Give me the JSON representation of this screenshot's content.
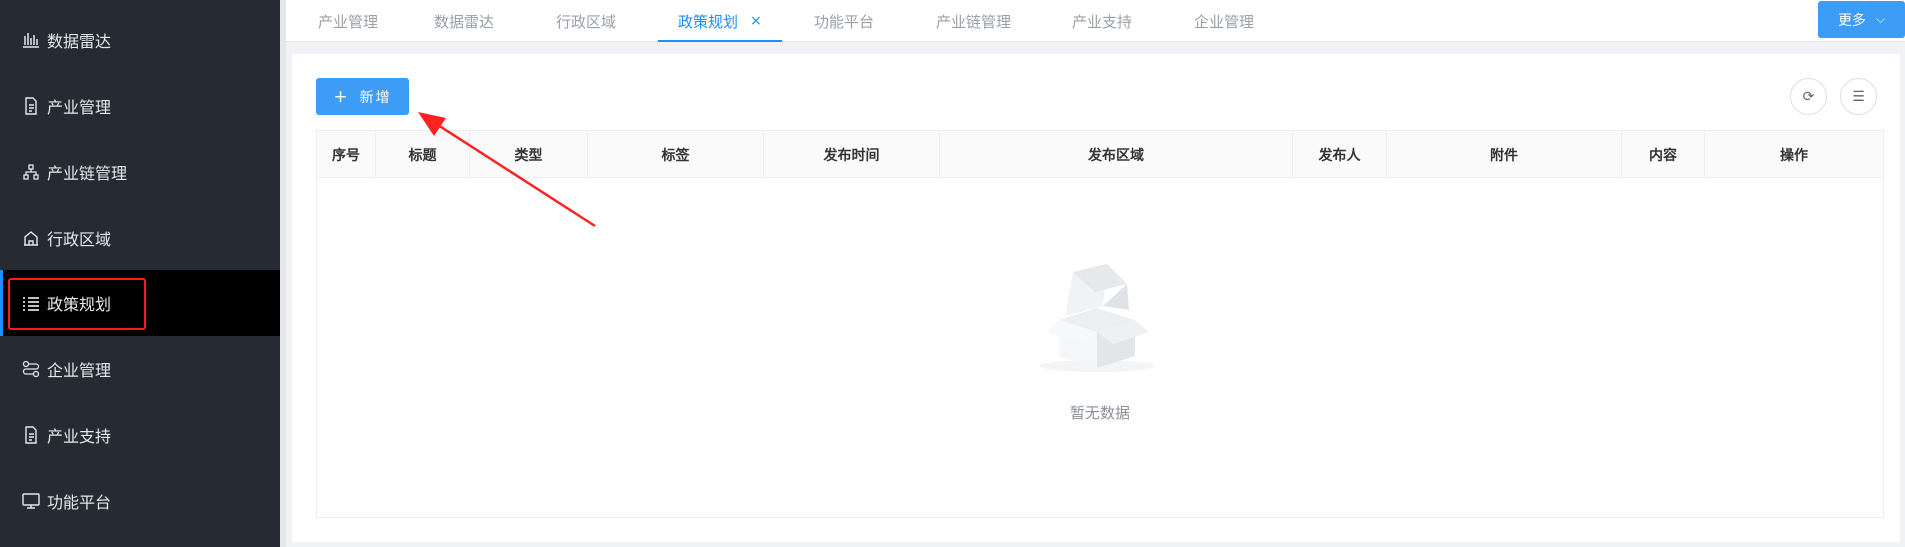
{
  "sidebar": {
    "items": [
      {
        "label": "数据雷达",
        "icon": "bar-chart-icon"
      },
      {
        "label": "产业管理",
        "icon": "document-icon"
      },
      {
        "label": "产业链管理",
        "icon": "hierarchy-icon"
      },
      {
        "label": "行政区域",
        "icon": "building-icon"
      },
      {
        "label": "政策规划",
        "icon": "list-icon"
      },
      {
        "label": "企业管理",
        "icon": "flow-icon"
      },
      {
        "label": "产业支持",
        "icon": "document-icon"
      },
      {
        "label": "功能平台",
        "icon": "monitor-icon"
      }
    ],
    "active_index": 4
  },
  "tabs": [
    {
      "label": "产业管理"
    },
    {
      "label": "数据雷达"
    },
    {
      "label": "行政区域"
    },
    {
      "label": "政策规划",
      "close": "×"
    },
    {
      "label": "功能平台"
    },
    {
      "label": "产业链管理"
    },
    {
      "label": "产业支持"
    },
    {
      "label": "企业管理"
    }
  ],
  "more_button": {
    "label": "更多",
    "chevron": "⌵"
  },
  "toolbar": {
    "add_label": "新增",
    "add_plus": "+",
    "refresh_glyph": "⟳",
    "settings_glyph": "☰"
  },
  "table": {
    "columns": [
      "序号",
      "标题",
      "类型",
      "标签",
      "发布时间",
      "发布区域",
      "发布人",
      "附件",
      "内容",
      "操作"
    ],
    "empty_text": "暂无数据"
  },
  "colors": {
    "accent": "#1890ff",
    "button": "#3d9cf5",
    "sidebar_bg": "#252a33",
    "highlight": "#ff1a1a"
  }
}
